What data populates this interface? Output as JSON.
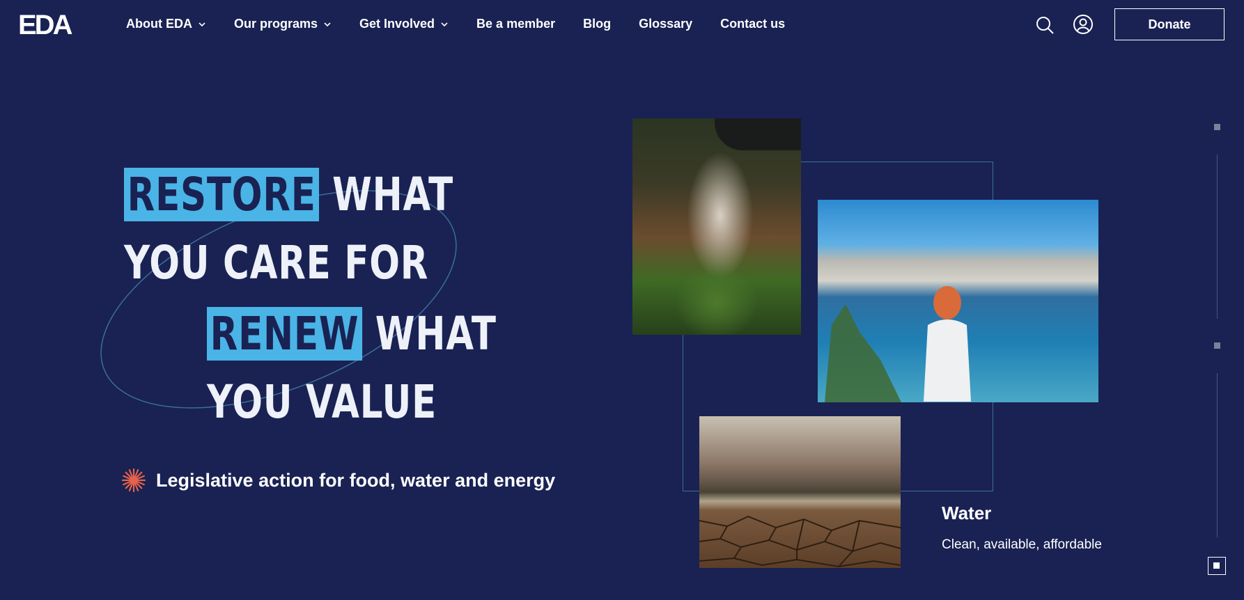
{
  "brand": {
    "logo_text": "EDA"
  },
  "nav": {
    "items": [
      {
        "label": "About EDA",
        "has_dropdown": true
      },
      {
        "label": "Our programs",
        "has_dropdown": true
      },
      {
        "label": "Get Involved",
        "has_dropdown": true
      },
      {
        "label": "Be a member",
        "has_dropdown": false
      },
      {
        "label": "Blog",
        "has_dropdown": false
      },
      {
        "label": "Glossary",
        "has_dropdown": false
      },
      {
        "label": "Contact us",
        "has_dropdown": false
      }
    ],
    "icons": [
      "search-icon",
      "user-icon"
    ],
    "donate_label": "Donate"
  },
  "hero": {
    "line1_highlight": "RESTORE",
    "line1_rest": "WHAT",
    "line2": "YOU CARE FOR",
    "line3_highlight": "RENEW",
    "line3_rest": "WHAT",
    "line4": "YOU VALUE",
    "tagline": "Legislative action for food, water and energy",
    "highlight_color": "#4bb4e6",
    "background_color": "#192253",
    "accent_color": "#e8624a"
  },
  "feature": {
    "title": "Water",
    "subtitle": "Clean, available, affordable"
  },
  "slider": {
    "slide_count": 3,
    "active_index": 2
  }
}
